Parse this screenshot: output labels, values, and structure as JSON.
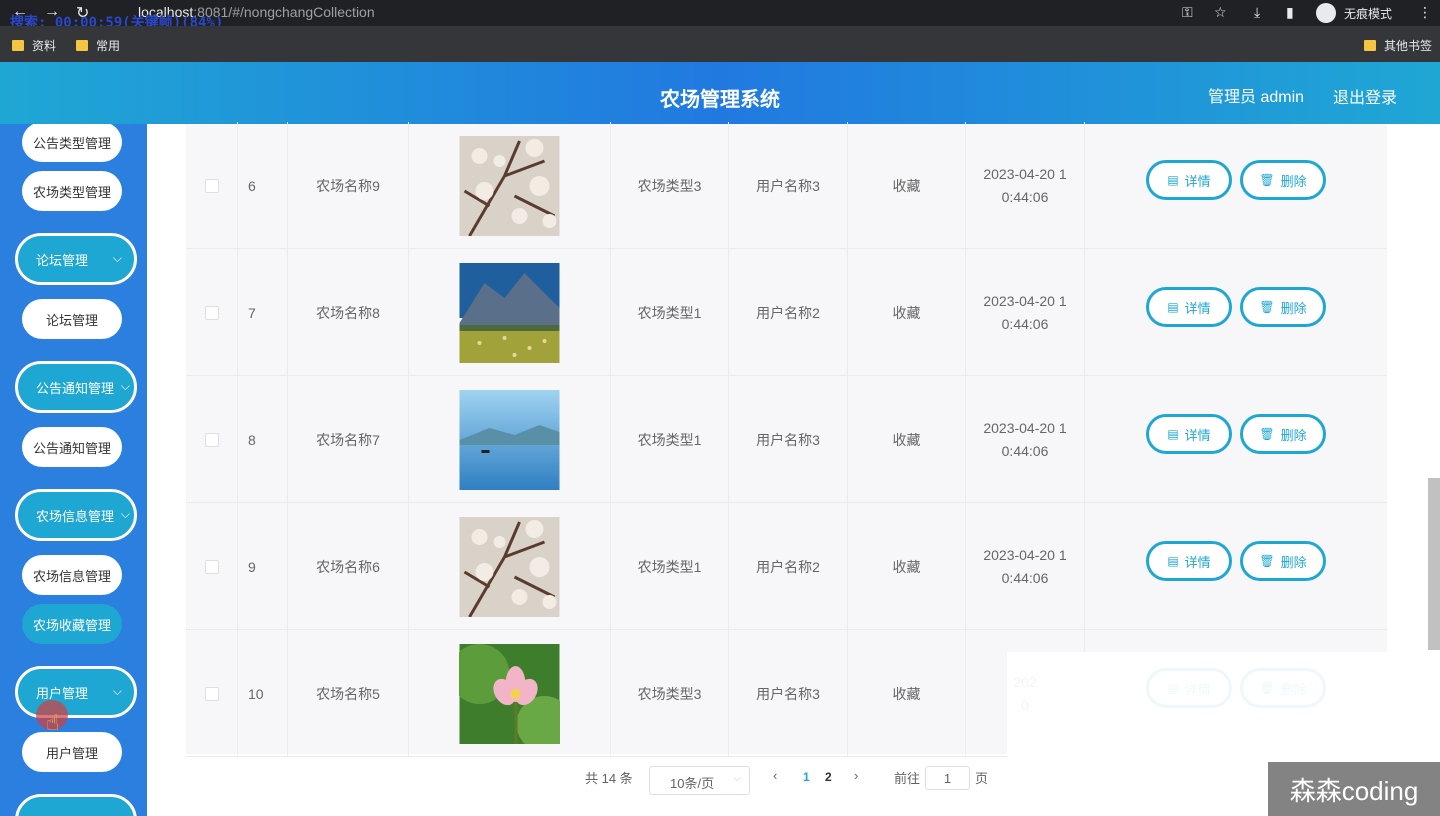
{
  "browser": {
    "url_host": "localhost",
    "url_rest": ":8081/#/nongchangCollection",
    "overlay": "搜索: 00:00:59(关键帧)(84%)",
    "incognito_label": "无痕模式",
    "bookmarks": [
      "资料",
      "常用"
    ],
    "other_bookmarks": "其他书签"
  },
  "header": {
    "title": "农场管理系统",
    "admin": "管理员 admin",
    "logout": "退出登录"
  },
  "sidebar": {
    "items": [
      {
        "label": "公告类型管理",
        "kind": "sub"
      },
      {
        "label": "农场类型管理",
        "kind": "sub"
      },
      {
        "label": "论坛管理",
        "kind": "group"
      },
      {
        "label": "论坛管理",
        "kind": "sub"
      },
      {
        "label": "公告通知管理",
        "kind": "group"
      },
      {
        "label": "公告通知管理",
        "kind": "sub"
      },
      {
        "label": "农场信息管理",
        "kind": "group"
      },
      {
        "label": "农场信息管理",
        "kind": "sub"
      },
      {
        "label": "农场收藏管理",
        "kind": "sub",
        "active": true
      },
      {
        "label": "用户管理",
        "kind": "group"
      },
      {
        "label": "用户管理",
        "kind": "sub"
      }
    ]
  },
  "table": {
    "rows": [
      {
        "index": "6",
        "name": "农场名称9",
        "type": "农场类型3",
        "user": "用户名称3",
        "collect": "收藏",
        "time_l1": "2023-04-20 1",
        "time_l2": "0:44:06",
        "image": "blossom"
      },
      {
        "index": "7",
        "name": "农场名称8",
        "type": "农场类型1",
        "user": "用户名称2",
        "collect": "收藏",
        "time_l1": "2023-04-20 1",
        "time_l2": "0:44:06",
        "image": "mountain"
      },
      {
        "index": "8",
        "name": "农场名称7",
        "type": "农场类型1",
        "user": "用户名称3",
        "collect": "收藏",
        "time_l1": "2023-04-20 1",
        "time_l2": "0:44:06",
        "image": "lake"
      },
      {
        "index": "9",
        "name": "农场名称6",
        "type": "农场类型1",
        "user": "用户名称2",
        "collect": "收藏",
        "time_l1": "2023-04-20 1",
        "time_l2": "0:44:06",
        "image": "blossom"
      },
      {
        "index": "10",
        "name": "农场名称5",
        "type": "农场类型3",
        "user": "用户名称3",
        "collect": "收藏",
        "time_l1": "202",
        "time_l2": "0",
        "image": "lotus"
      }
    ],
    "detail_label": "详情",
    "delete_label": "删除"
  },
  "pagination": {
    "total": "共 14 条",
    "page_size": "10条/页",
    "pages": [
      "1",
      "2"
    ],
    "current_page": "1",
    "goto_label": "前往",
    "goto_value": "1",
    "page_unit": "页"
  },
  "watermark": "森森coding",
  "colors": {
    "accent": "#1fa7d4",
    "sidebar": "#2b7fdf",
    "active_page": "#1fa7d4"
  }
}
